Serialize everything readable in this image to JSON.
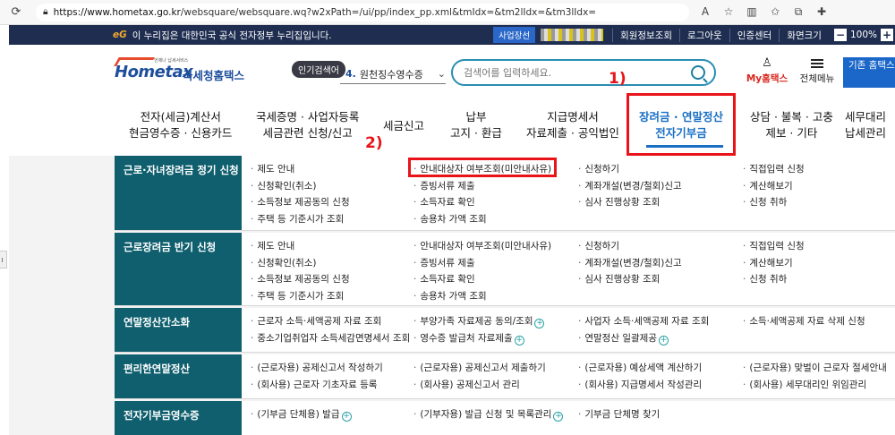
{
  "browser": {
    "url_host": "https://www.hometax.go.kr",
    "url_path": "/websquare/websquare.wq?w2xPath=/ui/pp/index_pp.xml&tmIdx=&tm2lIdx=&tm3lIdx=",
    "icons": [
      "reader-icon",
      "favorite-star-icon",
      "split-screen-icon",
      "favorites-icon",
      "collections-icon",
      "extensions-icon"
    ]
  },
  "topstrip": {
    "eg_logo": "eG",
    "notice": "이 누리집은 대한민국 공식 전자정부 누리집입니다.",
    "biz_badge": "사업장선",
    "links": [
      "회원정보조회",
      "로그아웃",
      "인증센터",
      "화면크기"
    ],
    "zoom": "100%",
    "zoom_minus": "−",
    "zoom_plus": "+"
  },
  "header": {
    "logo_text": "Hometax",
    "logo_sub": "언제나 납세서비스",
    "logo_kname": "국세청홈택스",
    "popular_label": "인기검색어",
    "rank_number": "4.",
    "rank_text": "원천징수영수증",
    "search_placeholder": "검색어를 입력하세요.",
    "my_home": "My홈택스",
    "all_menu": "전체메뉴",
    "old_home": "기존 홈택스 메뉴 보기"
  },
  "annotations": {
    "step1": "1)",
    "step2": "2)"
  },
  "gnb": [
    {
      "line1": "전자(세금)계산서",
      "line2": "현금영수증 · 신용카드"
    },
    {
      "line1": "국세증명 · 사업자등록",
      "line2": "세금관련 신청/신고"
    },
    {
      "line1": "세금신고",
      "line2": ""
    },
    {
      "line1": "납부",
      "line2": "고지 · 환급"
    },
    {
      "line1": "지급명세서",
      "line2": "자료제출 · 공익법인"
    },
    {
      "line1": "장려금 · 연말정산",
      "line2": "전자기부금"
    },
    {
      "line1": "상담 · 불복 · 고충",
      "line2": "제보 · 기타"
    },
    {
      "line1": "세무대리",
      "line2": "납세관리"
    }
  ],
  "menu": {
    "sections": [
      {
        "label": "근로·자녀장려금 정기 신청",
        "cols": [
          [
            "제도 안내",
            "신청확인(취소)",
            "소득정보 제공동의 신청",
            "주택 등 기준시가 조회"
          ],
          [
            "안내대상자 여부조회(미안내사유)",
            "증빙서류 제출",
            "소득자료 확인",
            "송용차 가액 조회"
          ],
          [
            "신청하기",
            "계좌개설(변경/철회)신고",
            "심사 진행상황 조회"
          ],
          [
            "직접입력 신청",
            "계산해보기",
            "신청 취하"
          ]
        ]
      },
      {
        "label": "근로장려금 반기 신청",
        "cols": [
          [
            "제도 안내",
            "신청확인(취소)",
            "소득정보 제공동의 신청",
            "주택 등 기준시가 조회"
          ],
          [
            "안내대상자 여부조회(미안내사유)",
            "증빙서류 제출",
            "소득자료 확인",
            "송용차 가액 조회"
          ],
          [
            "신청하기",
            "계좌개설(변경/철회)신고",
            "심사 진행상황 조회"
          ],
          [
            "직접입력 신청",
            "계산해보기",
            "신청 취하"
          ]
        ]
      },
      {
        "label": "연말정산간소화",
        "cols": [
          [
            "근로자 소득·세액공제 자료 조회",
            "중소기업취업자 소득세감면명세서 조회"
          ],
          [
            "부양가족 자료제공 동의/조회",
            "영수증 발급처 자료제출"
          ],
          [
            "사업자 소득·세액공제 자료 조회",
            "연말정산 일괄제공"
          ],
          [
            "소득·세액공제 자료 삭제 신청"
          ]
        ]
      },
      {
        "label": "편리한연말정산",
        "cols": [
          [
            "(근로자용) 공제신고서 작성하기",
            "(회사용) 근로자 기초자료 등록"
          ],
          [
            "(근로자용) 공제신고서 제출하기",
            "(회사용) 공제신고서 관리"
          ],
          [
            "(근로자용) 예상세액 계산하기",
            "(회사용) 지급명세서 작성관리"
          ],
          [
            "(근로자용) 맞벌이 근로자 절세안내",
            "(회사용) 세무대리인 위임관리"
          ]
        ]
      },
      {
        "label": "전자기부금영수증",
        "cols": [
          [
            "(기부금 단체용) 발급"
          ],
          [
            "(기부자용) 발급 신청 및 목록관리"
          ],
          [
            "기부금 단체명 찾기"
          ],
          []
        ]
      }
    ]
  }
}
